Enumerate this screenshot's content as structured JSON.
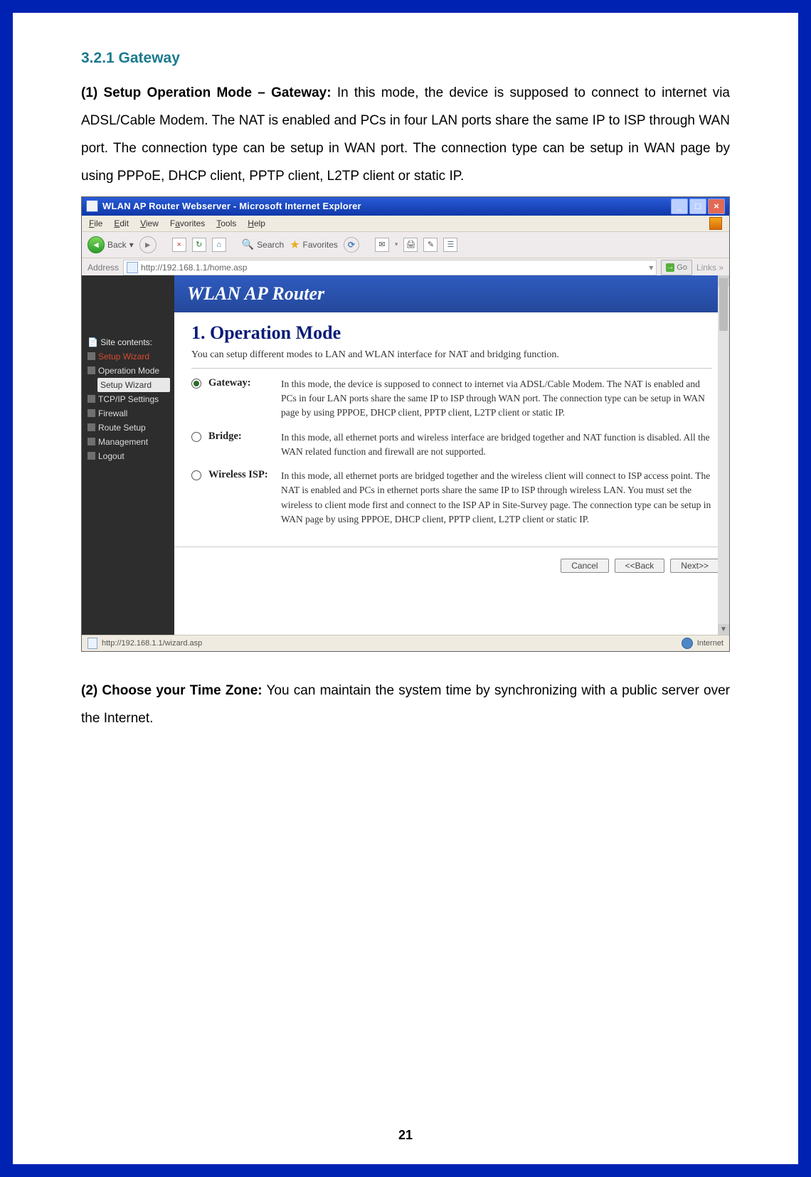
{
  "doc": {
    "heading": "3.2.1 Gateway",
    "para1_label": "(1) Setup Operation Mode – Gateway:",
    "para1_text": " In this mode, the device is supposed to connect to internet via ADSL/Cable Modem. The NAT is enabled and PCs in four LAN ports share the same IP to ISP through WAN port. The connection type can be setup in WAN port. The connection type can be setup in WAN page by using PPPoE, DHCP client, PPTP client, L2TP client or static IP.",
    "para2_label": "(2) Choose your Time Zone:",
    "para2_text": " You can maintain the system time by synchronizing with a public server over the Internet.",
    "page_number": "21"
  },
  "window": {
    "title": "WLAN AP Router Webserver - Microsoft Internet Explorer",
    "menu": {
      "file": "File",
      "edit": "Edit",
      "view": "View",
      "favorites": "Favorites",
      "tools": "Tools",
      "help": "Help"
    },
    "toolbar": {
      "back": "Back",
      "search": "Search",
      "favorites": "Favorites"
    },
    "address_label": "Address",
    "url": "http://192.168.1.1/home.asp",
    "go": "Go",
    "links": "Links"
  },
  "page": {
    "banner": "WLAN AP Router",
    "side_header": "Site contents:",
    "side_items": {
      "setup_wizard": "Setup Wizard",
      "operation_mode": "Operation Mode",
      "setup_wizard2": "Setup Wizard",
      "tcpip": "TCP/IP Settings",
      "firewall": "Firewall",
      "route": "Route Setup",
      "mgmt": "Management",
      "logout": "Logout"
    },
    "h1": "1. Operation Mode",
    "intro": "You can setup different modes to LAN and WLAN interface for NAT and bridging function.",
    "opts": {
      "gateway": {
        "label": "Gateway:",
        "desc": "In this mode, the device is supposed to connect to internet via ADSL/Cable Modem. The NAT is enabled and PCs in four LAN ports share the same IP to ISP through WAN port. The connection type can be setup in WAN page by using PPPOE, DHCP client, PPTP client, L2TP client or static IP."
      },
      "bridge": {
        "label": "Bridge:",
        "desc": "In this mode, all ethernet ports and wireless interface are bridged together and NAT function is disabled. All the WAN related function and firewall are not supported."
      },
      "wisp": {
        "label": "Wireless ISP:",
        "desc": "In this mode, all ethernet ports are bridged together and the wireless client will connect to ISP access point. The NAT is enabled and PCs in ethernet ports share the same IP to ISP through wireless LAN. You must set the wireless to client mode first and connect to the ISP AP in Site-Survey page. The connection type can be setup in WAN page by using PPPOE, DHCP client, PPTP client, L2TP client or static IP."
      }
    },
    "btn_cancel": "Cancel",
    "btn_back": "<<Back",
    "btn_next": "Next>>",
    "status_url": "http://192.168.1.1/wizard.asp",
    "status_zone": "Internet"
  }
}
